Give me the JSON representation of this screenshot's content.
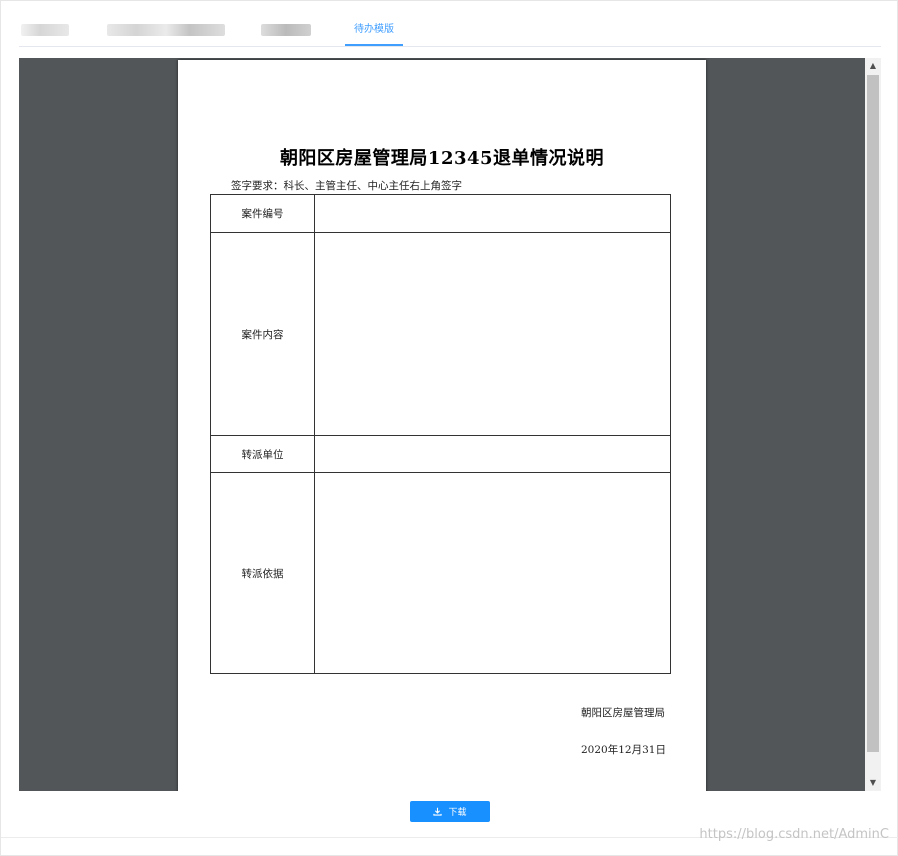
{
  "tabs": {
    "active_label": "待办模版"
  },
  "document": {
    "title": "朝阳区房屋管理局12345退单情况说明",
    "sign_requirement": "签字要求：科长、主管主任、中心主任右上角签字",
    "table": {
      "row1_label": "案件编号",
      "row2_label": "案件内容",
      "row3_label": "转派单位",
      "row4_label": "转派依据"
    },
    "footer_org": "朝阳区房屋管理局",
    "footer_date": "2020年12月31日"
  },
  "scrollbar": {
    "up_glyph": "▲",
    "down_glyph": "▼"
  },
  "actions": {
    "download_label": "下载"
  },
  "watermark": "https://blog.csdn.net/AdminC",
  "colors": {
    "accent": "#409eff",
    "button": "#1890ff",
    "viewer_bg": "#525659"
  },
  "icons": {
    "download": "download-icon"
  }
}
